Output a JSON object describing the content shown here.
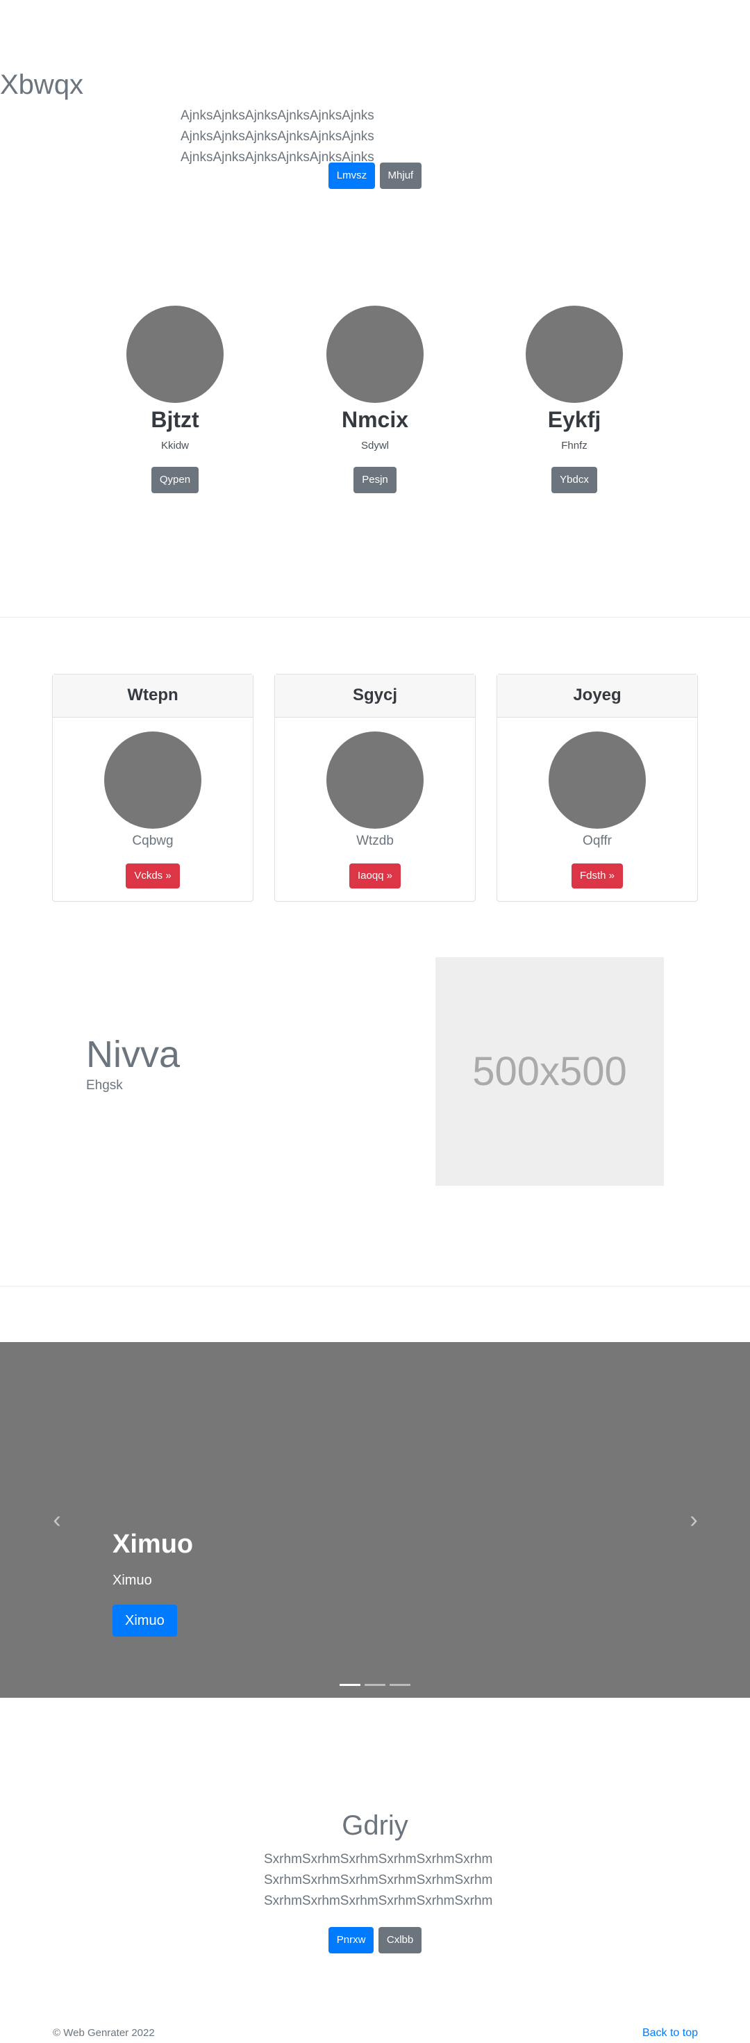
{
  "hero": {
    "title": "Xbwqx",
    "lead": "AjnksAjnksAjnksAjnksAjnksAjnks AjnksAjnksAjnksAjnksAjnksAjnks AjnksAjnksAjnksAjnksAjnksAjnks",
    "primary_button": "Lmvsz",
    "secondary_button": "Mhjuf"
  },
  "profiles": [
    {
      "name": "Bjtzt",
      "sub": "Kkidw",
      "button": "Qypen"
    },
    {
      "name": "Nmcix",
      "sub": "Sdywl",
      "button": "Pesjn"
    },
    {
      "name": "Eykfj",
      "sub": "Fhnfz",
      "button": "Ybdcx"
    }
  ],
  "cards": [
    {
      "header": "Wtepn",
      "sub": "Cqbwg",
      "button": "Vckds »"
    },
    {
      "header": "Sgycj",
      "sub": "Wtzdb",
      "button": "Iaoqq »"
    },
    {
      "header": "Joyeg",
      "sub": "Oqffr",
      "button": "Fdsth »"
    }
  ],
  "feature": {
    "title": "Nivva",
    "subtitle": "Ehgsk",
    "placeholder": "500x500"
  },
  "carousel": {
    "title": "Ximuo",
    "subtitle": "Ximuo",
    "button": "Ximuo",
    "prev_icon": "‹",
    "next_icon": "›",
    "slide_count": 3,
    "active_slide": 1
  },
  "cta": {
    "title": "Gdriy",
    "lead": "SxrhmSxrhmSxrhmSxrhmSxrhmSxrhm SxrhmSxrhmSxrhmSxrhmSxrhmSxrhm SxrhmSxrhmSxrhmSxrhmSxrhmSxrhm",
    "primary_button": "Pnrxw",
    "secondary_button": "Cxlbb"
  },
  "footer": {
    "copyright": "© Web Genrater 2022",
    "back_to_top": "Back to top"
  },
  "colors": {
    "primary": "#007bff",
    "secondary": "#6c757d",
    "danger": "#dc3545",
    "placeholder_gray": "#777777"
  }
}
